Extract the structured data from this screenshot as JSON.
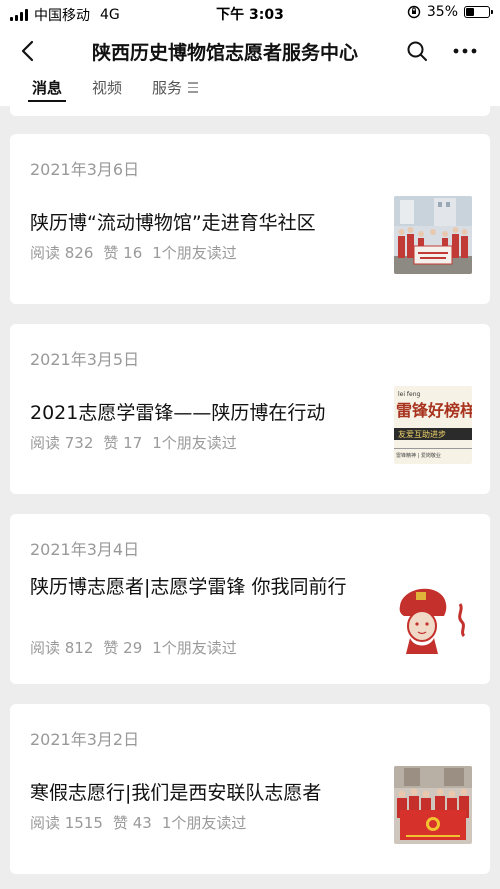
{
  "status_bar": {
    "carrier": "中国移动",
    "network": "4G",
    "time": "下午 3:03",
    "battery": "35%",
    "battery_level": 0.35
  },
  "nav": {
    "title": "陕西历史博物馆志愿者服务中心"
  },
  "tabs": [
    {
      "label": "消息",
      "active": true
    },
    {
      "label": "视频",
      "active": false
    },
    {
      "label": "服务",
      "active": false
    }
  ],
  "articles": [
    {
      "date": "2021年3月6日",
      "title": "陕历博“流动博物馆”走进育华社区",
      "reads": "阅读 826",
      "likes": "赞 16",
      "friends": "1个朋友读过"
    },
    {
      "date": "2021年3月5日",
      "title": "2021志愿学雷锋——陕历博在行动",
      "reads": "阅读 732",
      "likes": "赞 17",
      "friends": "1个朋友读过",
      "thumb_text": {
        "top": "lei feng",
        "main": "雷锋好榜样",
        "band": "友爱互助进步",
        "bottom": "雷锋精神 | 爱岗敬业"
      }
    },
    {
      "date": "2021年3月4日",
      "title": "陕历博志愿者|志愿学雷锋 你我同前行",
      "reads": "阅读 812",
      "likes": "赞 29",
      "friends": "1个朋友读过"
    },
    {
      "date": "2021年3月2日",
      "title": "寒假志愿行|我们是西安联队志愿者",
      "reads": "阅读 1515",
      "likes": "赞 43",
      "friends": "1个朋友读过"
    }
  ]
}
